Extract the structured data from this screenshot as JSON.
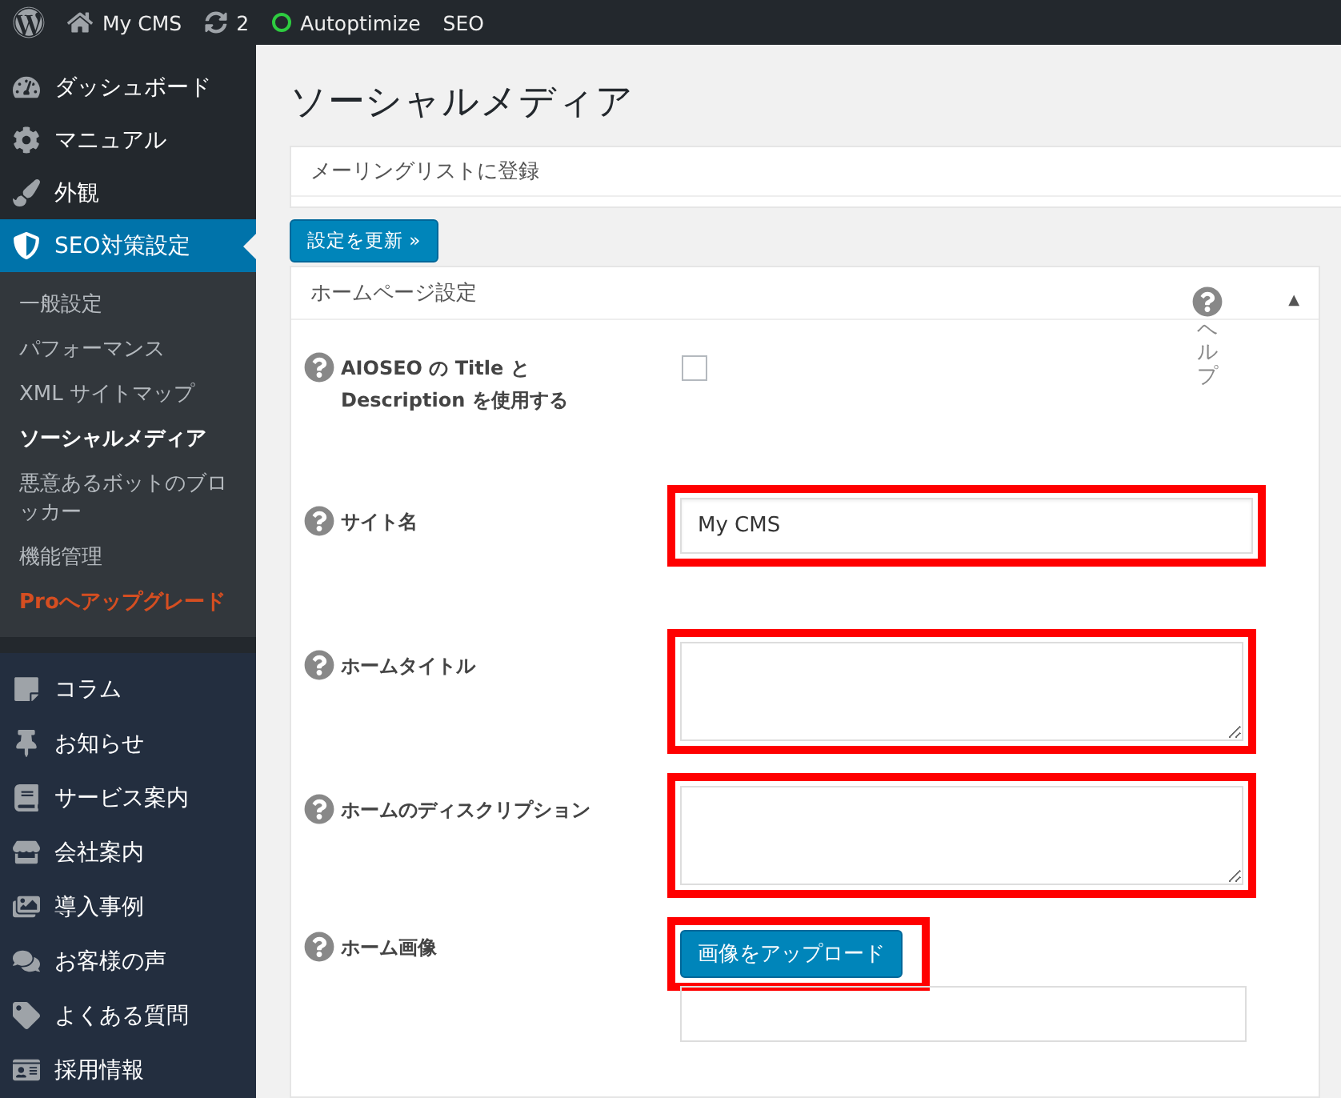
{
  "admin_bar": {
    "site": "My CMS",
    "updates": "2",
    "items": [
      {
        "label": "Autoptimize",
        "kind": "status"
      },
      {
        "label": "SEO",
        "kind": "plain"
      }
    ]
  },
  "menu_top": [
    {
      "label": "ダッシュボード",
      "selected": false
    },
    {
      "label": "マニュアル",
      "selected": false
    },
    {
      "label": "外観",
      "selected": false
    },
    {
      "label": "SEO対策設定",
      "selected": true
    }
  ],
  "submenu": [
    {
      "label": "一般設定",
      "kind": "link",
      "selected": false
    },
    {
      "label": "パフォーマンス",
      "kind": "link",
      "selected": false
    },
    {
      "label": "XML サイトマップ",
      "kind": "link",
      "selected": false
    },
    {
      "label": "ソーシャルメディア",
      "kind": "link",
      "selected": true
    },
    {
      "label": "悪意あるボットのブロッカー",
      "kind": "link",
      "selected": false
    },
    {
      "label": "機能管理",
      "kind": "link",
      "selected": false
    },
    {
      "label": "Proへアップグレード",
      "kind": "upgrade"
    }
  ],
  "menu_bottom": [
    {
      "label": "コラム"
    },
    {
      "label": "お知らせ"
    },
    {
      "label": "サービス案内"
    },
    {
      "label": "会社案内"
    },
    {
      "label": "導入事例"
    },
    {
      "label": "お客様の声"
    },
    {
      "label": "よくある質問"
    },
    {
      "label": "採用情報"
    }
  ],
  "page_title": "ソーシャルメディア",
  "mailing_list": "メーリングリストに登録",
  "update_button": "設定を更新 »",
  "panel": {
    "title": "ホームページ設定",
    "help": "ヘルプ",
    "collapse": "▲",
    "fields": [
      {
        "label": "AIOSEO の Title と Description を使用する",
        "kind": "checkbox",
        "checked": false
      },
      {
        "label": "サイト名",
        "kind": "text",
        "value": "My CMS",
        "highlighted": true
      },
      {
        "label": "ホームタイトル",
        "kind": "textarea",
        "highlighted": true
      },
      {
        "label": "ホームのディスクリプション",
        "kind": "textarea",
        "highlighted": true
      },
      {
        "label": "ホーム画像",
        "kind": "upload",
        "button": "画像をアップロード",
        "highlighted": true
      }
    ]
  }
}
